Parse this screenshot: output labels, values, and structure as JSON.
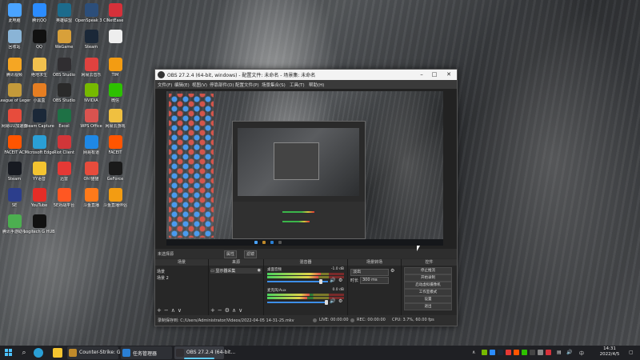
{
  "desktop": {
    "icons": [
      {
        "label": "此电脑",
        "color": "#4aa3ff"
      },
      {
        "label": "腾讯QQ",
        "color": "#2b8cff"
      },
      {
        "label": "英雄联盟",
        "color": "#1c6b8c"
      },
      {
        "label": "OpenSpeak 3 Client",
        "color": "#2c4e7a"
      },
      {
        "label": "NetEase",
        "color": "#d6313a"
      },
      {
        "label": "回收站",
        "color": "#8ab4d6"
      },
      {
        "label": "QQ",
        "color": "#111111"
      },
      {
        "label": "WeGame",
        "color": "#d8a03a"
      },
      {
        "label": "Steam",
        "color": "#1b2838"
      },
      {
        "label": "",
        "color": "#eeeeee"
      },
      {
        "label": "腾讯视频",
        "color": "#f5a623"
      },
      {
        "label": "绝地求生",
        "color": "#f2c14e"
      },
      {
        "label": "OBS Studio",
        "color": "#302e31"
      },
      {
        "label": "网易云音乐",
        "color": "#e0423f"
      },
      {
        "label": "TIM",
        "color": "#f39c12"
      },
      {
        "label": "League of Legends",
        "color": "#c49a3a"
      },
      {
        "label": "小黑盒",
        "color": "#e67e22"
      },
      {
        "label": "OBS Studio",
        "color": "#2a2a2a"
      },
      {
        "label": "NVIDIA",
        "color": "#76b900"
      },
      {
        "label": "微信",
        "color": "#2dc100"
      },
      {
        "label": "网易UU加速器",
        "color": "#e74c3c"
      },
      {
        "label": "Steam Capture",
        "color": "#1b2838"
      },
      {
        "label": "Excel",
        "color": "#1e7145"
      },
      {
        "label": "WPS Office",
        "color": "#d9534f"
      },
      {
        "label": "网易云游戏",
        "color": "#f0c040"
      },
      {
        "label": "FACEIT AC",
        "color": "#ff5500"
      },
      {
        "label": "Microsoft Edge",
        "color": "#2a9fd6"
      },
      {
        "label": "Riot Client",
        "color": "#d13639"
      },
      {
        "label": "网易有道",
        "color": "#1e88e5"
      },
      {
        "label": "FACEIT",
        "color": "#ff5500"
      },
      {
        "label": "Steam",
        "color": "#171a21"
      },
      {
        "label": "YY语音",
        "color": "#f4c430"
      },
      {
        "label": "迅雷",
        "color": "#e53935"
      },
      {
        "label": "Oh!猫猫",
        "color": "#e74c3c"
      },
      {
        "label": "GeForce",
        "color": "#1a1a1a"
      },
      {
        "label": "SE",
        "color": "#2c3e8c"
      },
      {
        "label": "YouTube",
        "color": "#e52d27"
      },
      {
        "label": "5E对战平台",
        "color": "#ff5722"
      },
      {
        "label": "斗鱼直播",
        "color": "#ff7a1a"
      },
      {
        "label": "斗鱼直播伴侣",
        "color": "#f39c12"
      },
      {
        "label": "腾讯手游助手",
        "color": "#4caf50"
      },
      {
        "label": "Logitech G HUB",
        "color": "#111111"
      }
    ]
  },
  "obs": {
    "title": "OBS 27.2.4 (64-bit, windows) - 配置文件: 未命名 - 场景集: 未命名",
    "menu": [
      "文件(F)",
      "编辑(E)",
      "视图(V)",
      "停靠部件(D)",
      "配置文件(P)",
      "场景集合(S)",
      "工具(T)",
      "帮助(H)"
    ],
    "no_source": "未选择源",
    "strip_buttons": [
      "属性",
      "滤镜"
    ],
    "docks": {
      "scenes": {
        "title": "场景",
        "items": [
          "场景",
          "场景 2"
        ]
      },
      "sources": {
        "title": "来源",
        "items": [
          "显示器采集"
        ]
      },
      "mixer": {
        "title": "混音器",
        "channels": [
          {
            "name": "桌面音频",
            "db": "-1.0 dB",
            "level": 0.7,
            "volume": 0.9
          },
          {
            "name": "麦克风/Aux",
            "db": "0.0 dB",
            "level": 0.55,
            "volume": 1.0
          }
        ]
      },
      "transitions": {
        "title": "场景转场",
        "type": "淡出",
        "duration_label": "时长",
        "duration": "300 ms"
      },
      "controls": {
        "title": "控件",
        "buttons": [
          "停止推流",
          "开始录制",
          "启动虚拟摄像机",
          "工作室模式",
          "设置",
          "退出"
        ]
      }
    },
    "statusbar": {
      "recording_path": "录制保存到: C:/Users/Administrator/Videos/2022-04-05 14-31-25.mkv",
      "live": "LIVE: 00:00:00",
      "rec": "REC: 00:00:00",
      "cpu": "CPU: 3.7%, 60.00 fps"
    }
  },
  "taskbar": {
    "apps": [
      {
        "label": "Counter-Strike: Gl...",
        "color": "#c08a2a",
        "active": false
      },
      {
        "label": "任务管理器",
        "color": "#2a7fd4",
        "active": false
      },
      {
        "label": "OBS 27.2.4 (64-bit...",
        "color": "#302e31",
        "active": true
      }
    ],
    "time": "14:31",
    "date": "2022/4/5",
    "lang": "中"
  }
}
